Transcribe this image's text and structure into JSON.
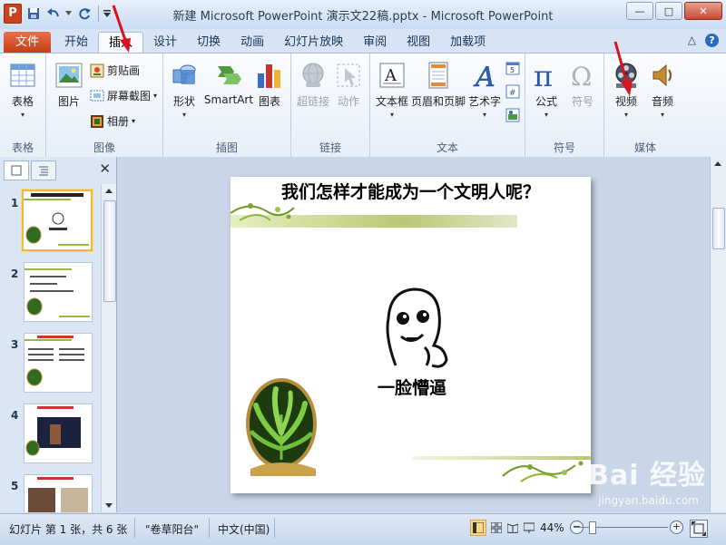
{
  "window": {
    "title": "新建 Microsoft PowerPoint 演示文22稿.pptx - Microsoft PowerPoint",
    "app_icon_letter": "P",
    "controls": {
      "minimize": "—",
      "maximize": "□",
      "close": "✕"
    }
  },
  "tabs": {
    "file": "文件",
    "items": [
      "开始",
      "插入",
      "设计",
      "切换",
      "动画",
      "幻灯片放映",
      "审阅",
      "视图",
      "加载项"
    ],
    "active": "插入",
    "right_caret": "△",
    "help": "?"
  },
  "ribbon": {
    "groups": {
      "table": {
        "label": "表格",
        "buttons": {
          "table": "表格"
        }
      },
      "images": {
        "label": "图像",
        "buttons": {
          "picture": "图片",
          "clipart": "剪贴画",
          "screenshot": "屏幕截图",
          "album": "相册"
        }
      },
      "illustrations": {
        "label": "插图",
        "buttons": {
          "shapes": "形状",
          "smartart": "SmartArt",
          "chart": "图表"
        }
      },
      "links": {
        "label": "链接",
        "buttons": {
          "hyperlink": "超链接",
          "action": "动作"
        }
      },
      "text": {
        "label": "文本",
        "buttons": {
          "textbox": "文本框",
          "header_footer": "页眉和页脚",
          "wordart": "艺术字"
        }
      },
      "symbols": {
        "label": "符号",
        "buttons": {
          "equation": "公式",
          "symbol": "符号"
        }
      },
      "media": {
        "label": "媒体",
        "buttons": {
          "video": "视频",
          "audio": "音频"
        }
      }
    },
    "dropdown_glyph": "▾"
  },
  "slides_pane": {
    "close": "✕",
    "slides": [
      {
        "number": "1",
        "selected": true
      },
      {
        "number": "2",
        "selected": false
      },
      {
        "number": "3",
        "selected": false
      },
      {
        "number": "4",
        "selected": false
      },
      {
        "number": "5",
        "selected": false
      }
    ]
  },
  "slide": {
    "title": "我们怎样才能成为一个文明人呢？",
    "caption": "一脸懵逼"
  },
  "watermark": {
    "main": "Bai 经验",
    "sub": "jingyan.baidu.com"
  },
  "statusbar": {
    "slide_info": "幻灯片 第 1 张，共 6 张",
    "theme": "\"卷草阳台\"",
    "language": "中文(中国)",
    "zoom": "44%",
    "zoom_minus": "−",
    "zoom_plus": "+",
    "zoom_level": 0.44
  },
  "colors": {
    "file_tab": "#d0461d",
    "ribbon_bg": "#f3f7fc",
    "title_bar": "#d6e4f5",
    "selected_slide_border": "#f4b73d",
    "arrow_red": "#d8121e"
  }
}
